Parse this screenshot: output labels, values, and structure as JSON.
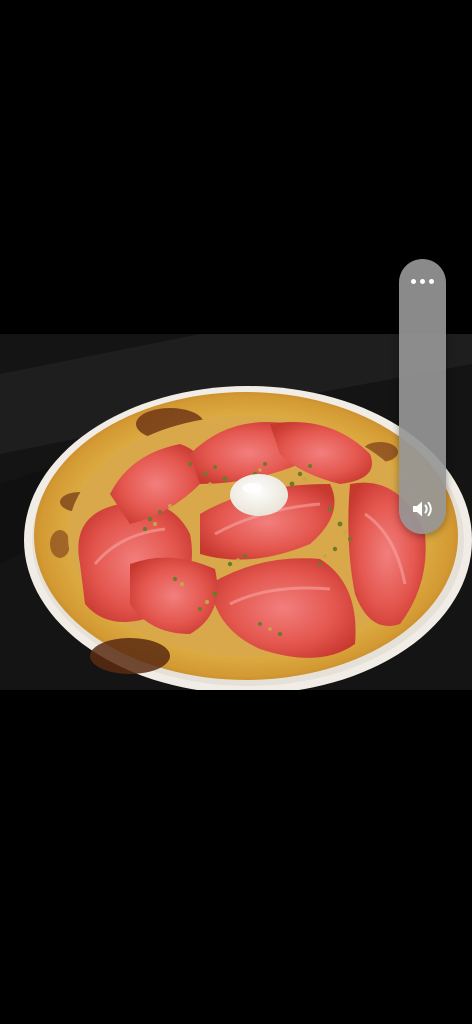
{
  "volume_panel": {
    "level": 0.0,
    "more_icon": "more-horizontal-icon",
    "speaker_icon": "speaker-volume-icon"
  },
  "photo": {
    "subject": "pizza-photo"
  },
  "colors": {
    "background": "#000000",
    "panel": "#969696",
    "icon": "#ffffff"
  }
}
